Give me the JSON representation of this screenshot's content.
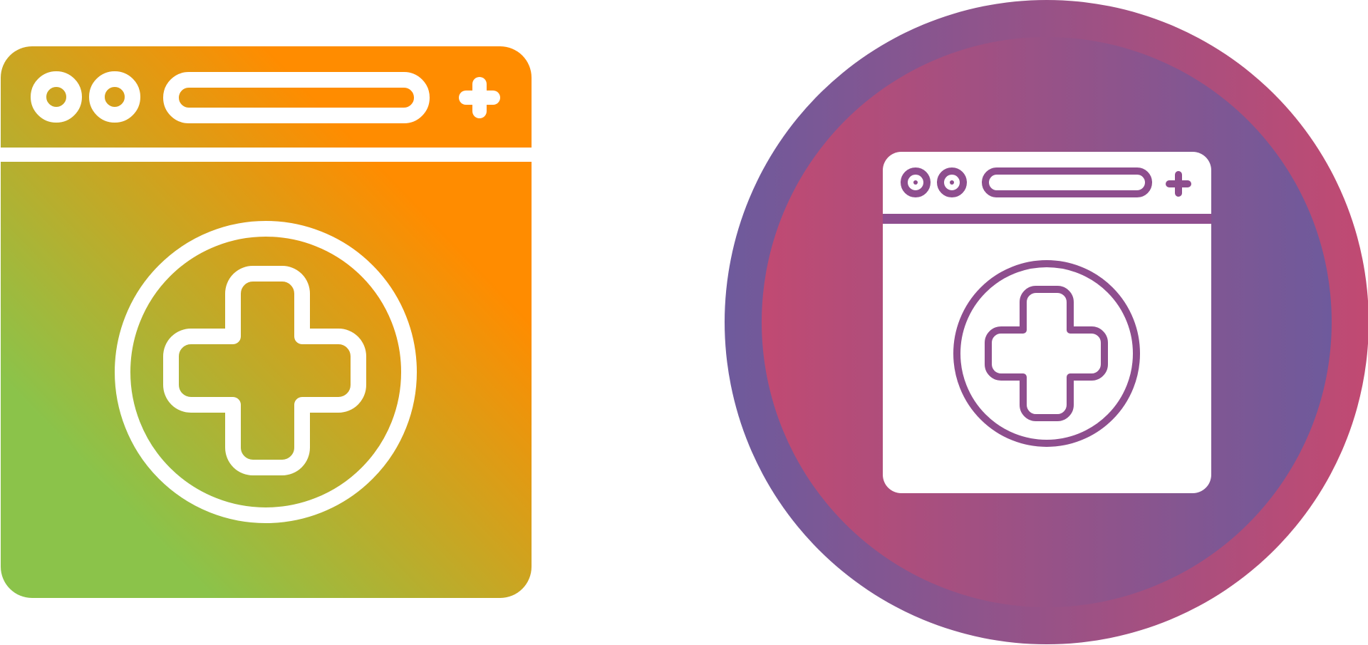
{
  "icons": [
    {
      "name": "browser-medical-icon",
      "style": "gradient-fill",
      "gradient": {
        "from": "#8BC34A",
        "to": "#FF8C00"
      }
    },
    {
      "name": "browser-medical-icon",
      "style": "circle-badge",
      "outer_gradient": {
        "from": "#6E5A9C",
        "to": "#C14A72"
      },
      "inner_gradient": {
        "from": "#C14A72",
        "to": "#6E5A9C"
      },
      "stroke_color": "#8E4E8E"
    }
  ]
}
